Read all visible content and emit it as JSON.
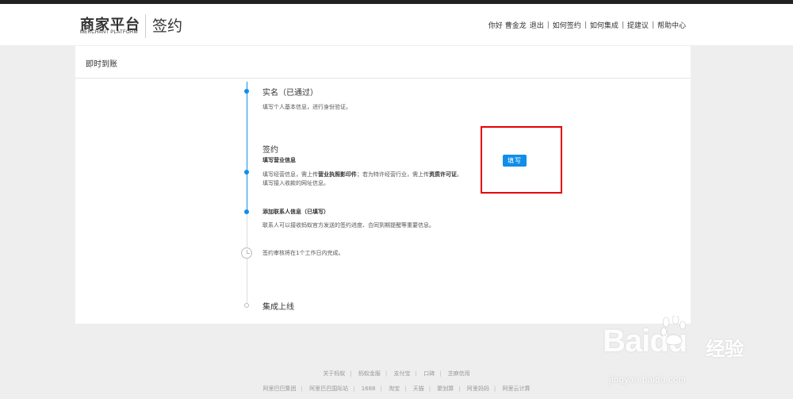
{
  "header": {
    "logo_text": "商家平台",
    "logo_subtitle": "MERCHANT PLATFORM",
    "page_name": "签约",
    "greeting": "你好 曹金龙",
    "logout": "退出",
    "nav_links": [
      "如何签约",
      "如何集成",
      "提建议",
      "帮助中心"
    ]
  },
  "panel": {
    "title": "即时到账",
    "steps": [
      {
        "title": "实名（已通过）",
        "description": "填写个人基本信息，进行身份验证。",
        "status": "done"
      },
      {
        "title": "签约",
        "substeps": [
          {
            "title": "填写营业信息",
            "description_parts": [
              "填写经营信息，需上传",
              "营业执照影印件",
              "；若为特许经营行业，需上传",
              "资质许可证",
              "。"
            ],
            "description_line2": "填写接入收款的网址信息。",
            "status": "active",
            "action_label": "填写"
          },
          {
            "title": "添加联系人信息（已填写）",
            "description": "联系人可以接收蚂蚁官方发送的签约进度、合同到期提醒等重要信息。",
            "status": "done"
          }
        ]
      },
      {
        "title": "",
        "description": "签约审核将在1个工作日内完成。",
        "status": "pending",
        "icon": "clock-icon"
      },
      {
        "title": "集成上线",
        "status": "todo"
      }
    ]
  },
  "footer": {
    "row1": [
      "关于蚂蚁",
      "蚂蚁金服",
      "支付宝",
      "口碑",
      "芝麻信用"
    ],
    "row2": [
      "阿里巴巴集团",
      "阿里巴巴国际站",
      "1688",
      "淘宝",
      "天猫",
      "聚划算",
      "阿里妈妈",
      "阿里云计算"
    ]
  },
  "watermark": {
    "logo": "Baidu",
    "product": "经验",
    "url": "jingyan.baidu.com"
  },
  "colors": {
    "accent": "#108ee9",
    "highlight_box": "#e60000",
    "background": "#eeeeee"
  }
}
